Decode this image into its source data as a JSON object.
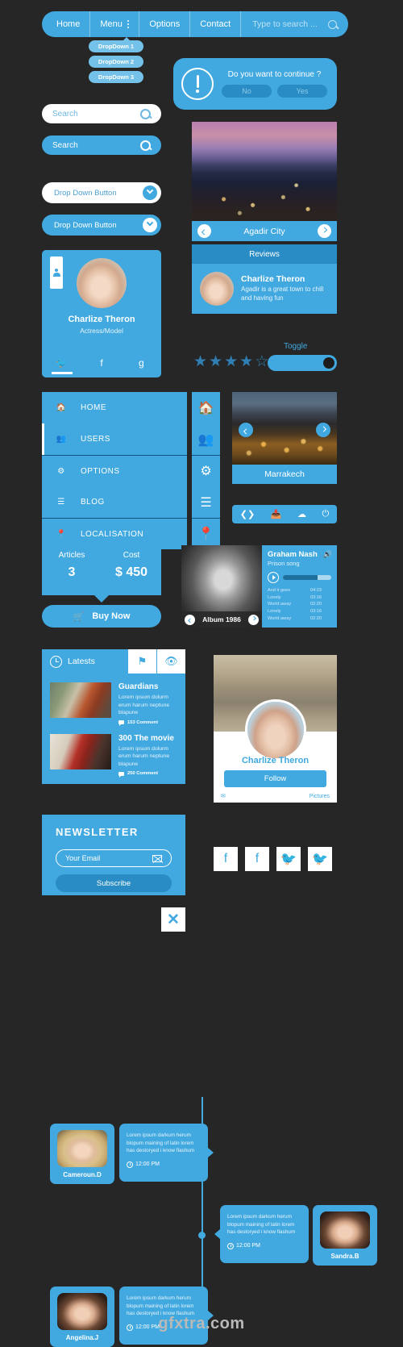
{
  "topnav": {
    "items": [
      "Home",
      "Menu",
      "Options",
      "Contact"
    ],
    "search_placeholder": "Type to search ...",
    "dropdown": [
      "DropDown 1",
      "DropDown 2",
      "DropDown 3"
    ]
  },
  "confirm": {
    "question": "Do you want to continue ?",
    "no": "No",
    "yes": "Yes"
  },
  "searchbars": {
    "white_placeholder": "Search",
    "blue_placeholder": "Search"
  },
  "dropdown_buttons": {
    "white": "Drop Down Button",
    "blue": "Drop Down Button"
  },
  "profile": {
    "name": "Charlize Theron",
    "role": "Actress/Model",
    "social": [
      "twitter-icon",
      "facebook-icon",
      "google-plus-icon"
    ]
  },
  "agadir": {
    "title": "Agadir City",
    "reviews_header": "Reviews",
    "review": {
      "name": "Charlize Theron",
      "text": "Agadir is a great town to chill and having fun"
    }
  },
  "rating": {
    "toggle_label": "Toggle",
    "filled": 4,
    "total": 5
  },
  "navmenu": {
    "items": [
      "HOME",
      "USERS",
      "OPTIONS",
      "BLOG",
      "LOCALISATION"
    ],
    "icons": [
      "home-icon",
      "users-icon",
      "gear-icon",
      "list-icon",
      "pin-icon"
    ]
  },
  "marrakech": {
    "title": "Marrakech"
  },
  "iconbar": {
    "icons": [
      "prev-next-icon",
      "inbox-icon",
      "cloud-icon",
      "power-icon"
    ]
  },
  "articles": {
    "label_articles": "Articles",
    "label_cost": "Cost",
    "value_articles": "3",
    "value_cost": "$ 450",
    "buy_now": "Buy Now"
  },
  "music": {
    "artist": "Graham Nash",
    "song": "Prison song",
    "album": "Album 1986",
    "tracks": [
      {
        "name": "And it goes",
        "time": "04:23"
      },
      {
        "name": "Lonely",
        "time": "03:16"
      },
      {
        "name": "World away",
        "time": "02:20"
      },
      {
        "name": "Lonely",
        "time": "03:16"
      },
      {
        "name": "World away",
        "time": "02:20"
      }
    ]
  },
  "latests": {
    "tab_label": "Latests",
    "tab_icons": [
      "flag-icon",
      "eye-icon"
    ],
    "posts": [
      {
        "title": "Guardians",
        "excerpt": "Lorem ipsum dolurm erum harum neptune blapune",
        "comments": "153 Comment"
      },
      {
        "title": "300 The movie",
        "excerpt": "Lorem ipsum dolurm erum harum neptune blapune",
        "comments": "250 Comment"
      }
    ]
  },
  "newsletter": {
    "title": "NEWSLETTER",
    "email_placeholder": "Your Email",
    "subscribe": "Subscribe",
    "close": "✕"
  },
  "follow_card": {
    "name": "Charlize Theron",
    "button": "Follow",
    "footer_right": "Pictures"
  },
  "social_squares": [
    "facebook-icon",
    "facebook-icon",
    "twitter-icon",
    "twitter-icon"
  ],
  "timeline": [
    {
      "name": "Cameroun.D",
      "text": "Lorem ipsum darkum herum blopum maining of latin lorem has destoryed i know flashum",
      "time": "12:00 PM",
      "side": "left"
    },
    {
      "name": "Sandra.B",
      "text": "Lorem ipsum darkum herum blopum maining of latin lorem has destoryed i know flashum",
      "time": "12:00 PM",
      "side": "right"
    },
    {
      "name": "Angelina.J",
      "text": "Lorem ipsum darkum herum blopum maining of latin lorem has destoryed i know flashum",
      "time": "12:00 PM",
      "side": "left"
    }
  ],
  "footer": "gfxtra.com",
  "colors": {
    "accent": "#41a9e0",
    "accent_dark": "#2a8cc4",
    "accent_light": "#74c2ea",
    "background": "#262626",
    "white": "#ffffff"
  }
}
